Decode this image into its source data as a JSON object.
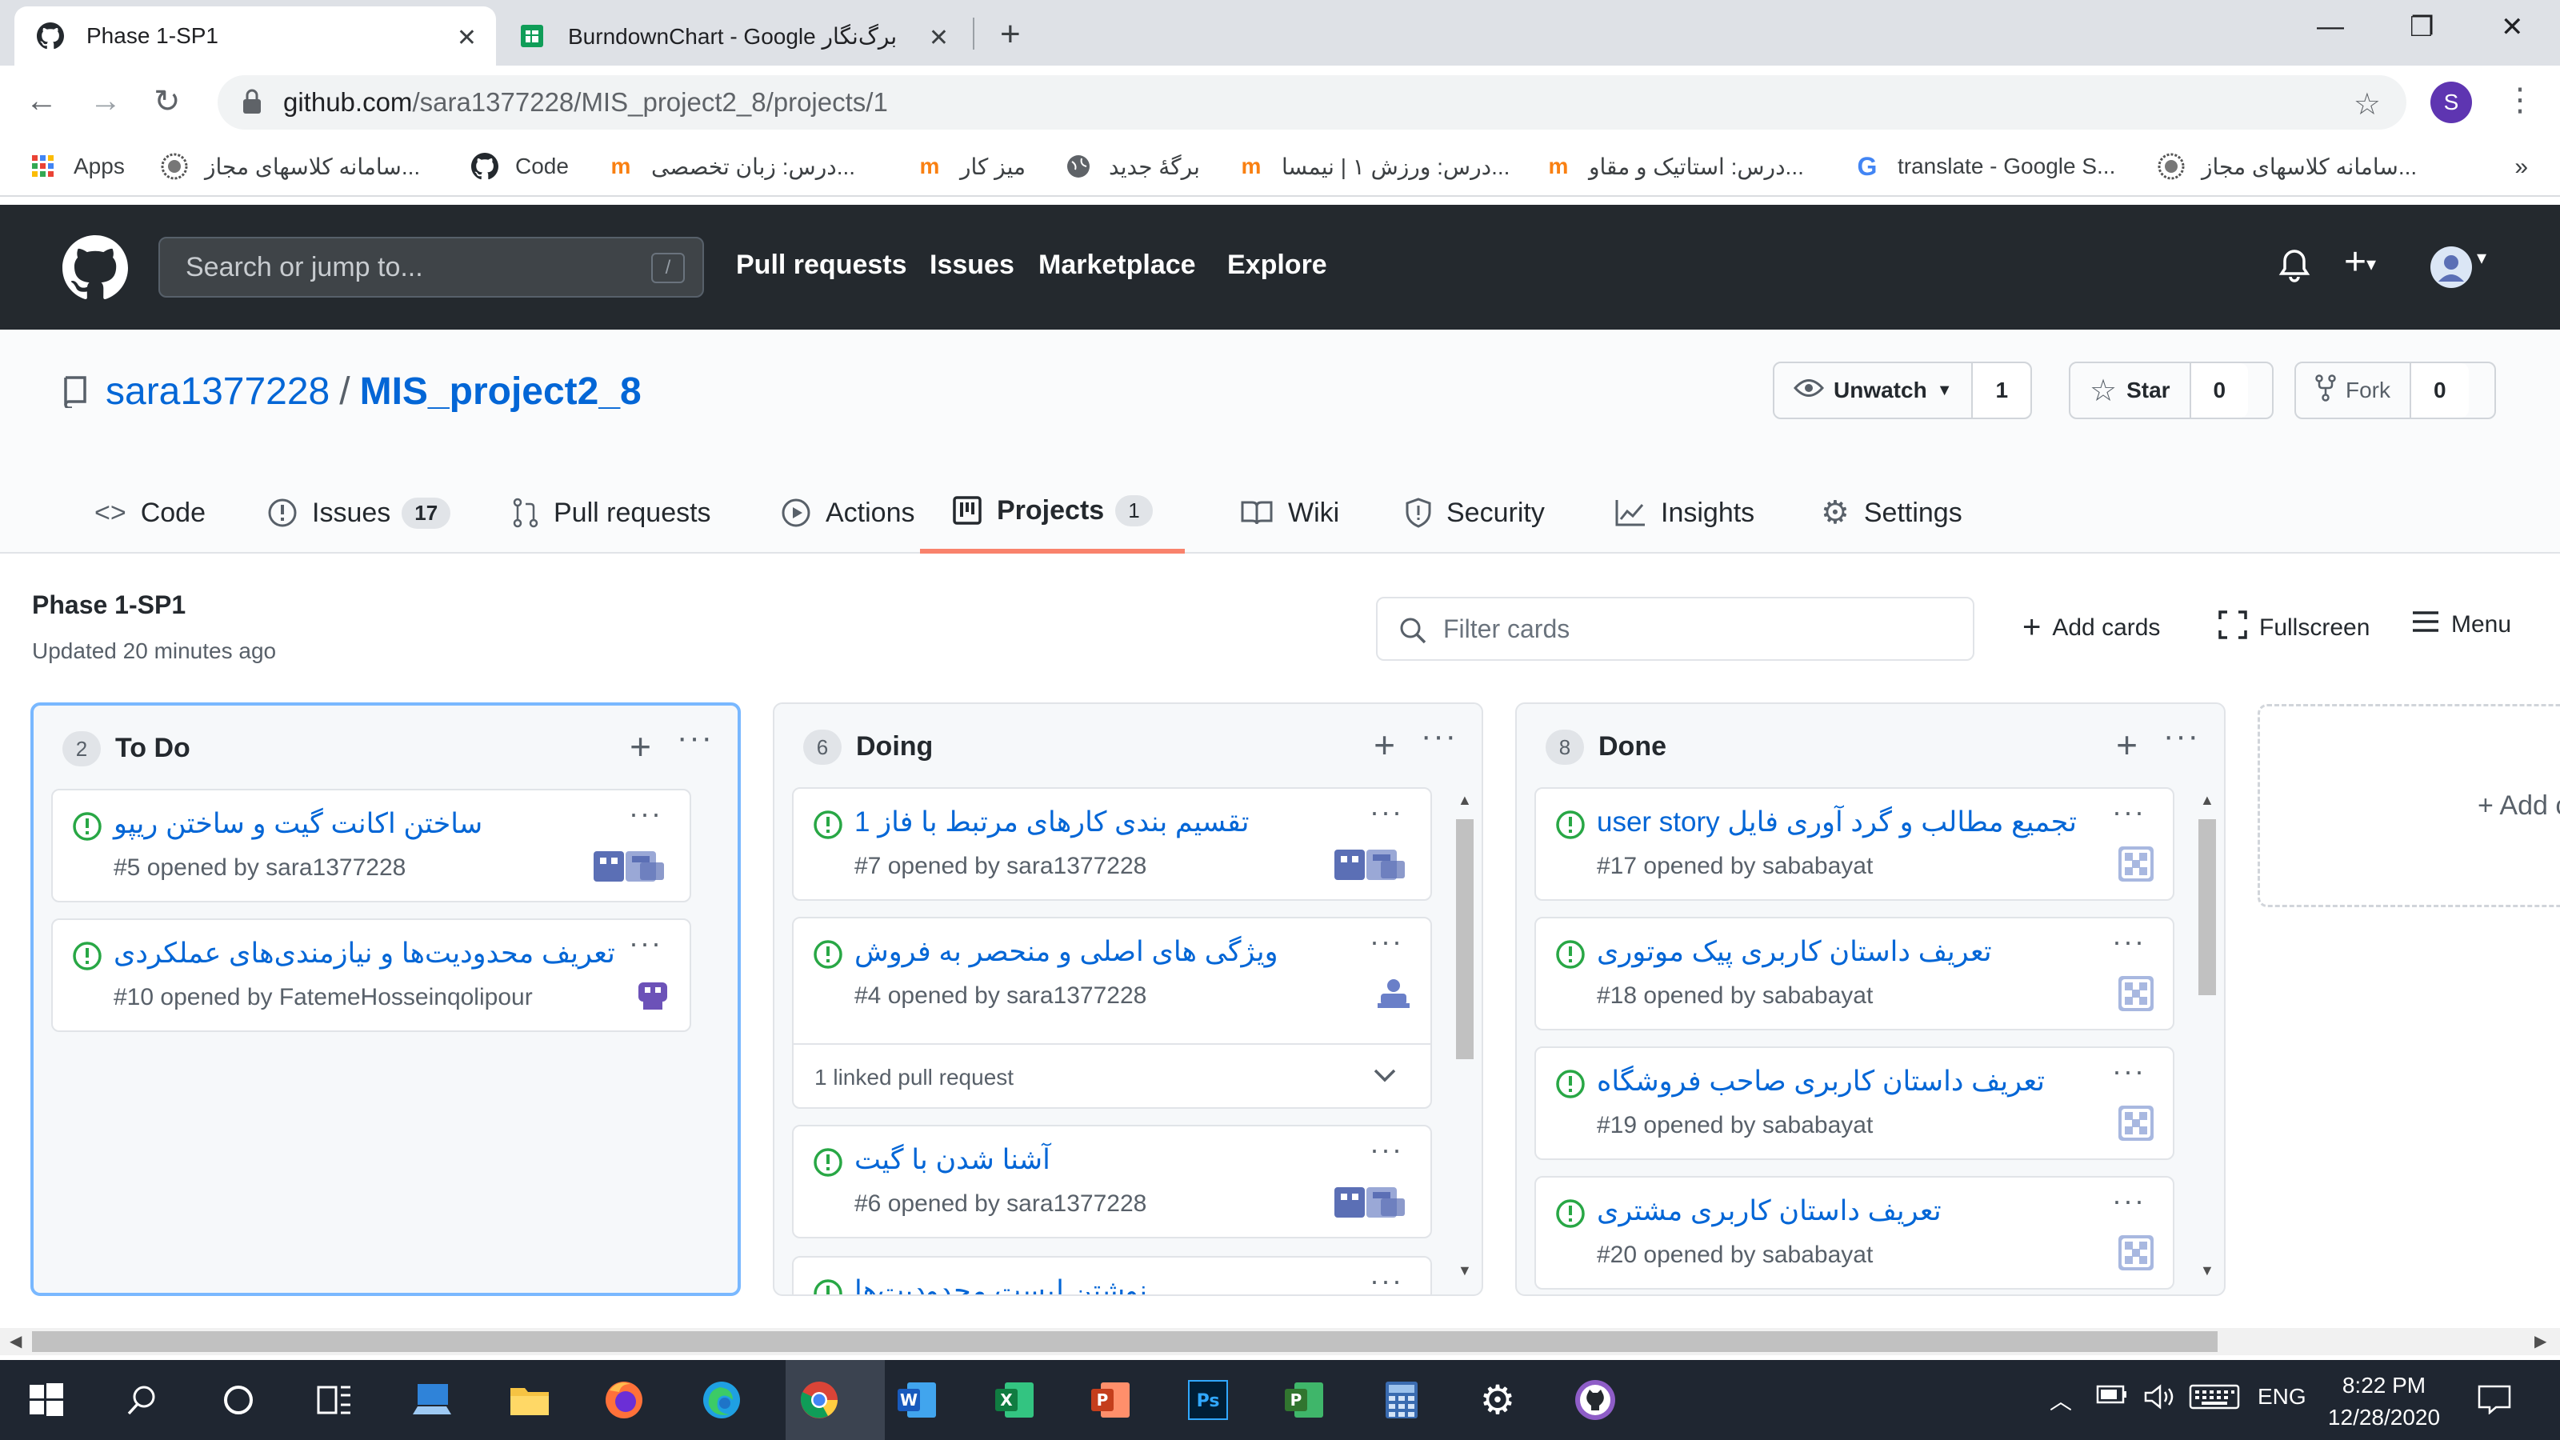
{
  "browser": {
    "tabs": [
      {
        "title": "Phase 1-SP1",
        "icon": "github-icon",
        "active": true
      },
      {
        "title": "BurndownChart - Google برگ‌نگار",
        "icon": "sheets-icon",
        "active": false
      }
    ],
    "close_glyph": "✕",
    "new_tab_glyph": "+",
    "url_host": "github.com",
    "url_path": "/sara1377228/MIS_project2_8/projects/1",
    "profile_initial": "S",
    "bookmarks": [
      {
        "label": "Apps",
        "icon": "apps-grid-icon"
      },
      {
        "label": "سامانه کلاسهای مجاز...",
        "icon": "seal-icon"
      },
      {
        "label": "Code",
        "icon": "github-icon"
      },
      {
        "label": "درس: زبان تخصصی...",
        "icon": "moodle-icon"
      },
      {
        "label": "میز کار",
        "icon": "moodle-icon"
      },
      {
        "label": "برگهٔ جدید",
        "icon": "globe-icon"
      },
      {
        "label": "درس: ورزش ۱ | نیمسا...",
        "icon": "moodle-icon"
      },
      {
        "label": "درس: استاتیک و مقاو...",
        "icon": "moodle-icon"
      },
      {
        "label": "translate - Google S...",
        "icon": "google-icon"
      },
      {
        "label": "سامانه کلاسهای مجاز...",
        "icon": "seal-icon"
      }
    ],
    "bookmarks_more": "»"
  },
  "github": {
    "search_placeholder": "Search or jump to...",
    "search_key": "/",
    "nav": [
      "Pull requests",
      "Issues",
      "Marketplace",
      "Explore"
    ]
  },
  "repo": {
    "owner": "sara1377228",
    "separator": "/",
    "name": "MIS_project2_8",
    "unwatch_label": "Unwatch",
    "watch_count": "1",
    "star_label": "Star",
    "star_count": "0",
    "fork_label": "Fork",
    "fork_count": "0",
    "tabs": [
      {
        "label": "Code",
        "icon": "code-icon",
        "counter": ""
      },
      {
        "label": "Issues",
        "icon": "issue-icon",
        "counter": "17"
      },
      {
        "label": "Pull requests",
        "icon": "pull-request-icon",
        "counter": ""
      },
      {
        "label": "Actions",
        "icon": "play-icon",
        "counter": ""
      },
      {
        "label": "Projects",
        "icon": "project-icon",
        "counter": "1",
        "selected": true
      },
      {
        "label": "Wiki",
        "icon": "book-icon",
        "counter": ""
      },
      {
        "label": "Security",
        "icon": "shield-icon",
        "counter": ""
      },
      {
        "label": "Insights",
        "icon": "graph-icon",
        "counter": ""
      },
      {
        "label": "Settings",
        "icon": "gear-icon",
        "counter": ""
      }
    ]
  },
  "project": {
    "title": "Phase 1-SP1",
    "updated": "Updated 20 minutes ago",
    "filter_placeholder": "Filter cards",
    "add_cards": "Add cards",
    "fullscreen": "Fullscreen",
    "menu": "Menu",
    "add_column": "+ Add column",
    "columns": [
      {
        "name": "To Do",
        "count": "2",
        "cards": [
          {
            "title": "ساختن اکانت گیت و ساختن ریپو",
            "meta": "#5 opened by sara1377228",
            "avatar": "multi"
          },
          {
            "title": "تعریف محدودیت‌ها و نیازمندی‌های عملکردی",
            "meta": "#10 opened by FatemeHosseinqolipour",
            "avatar": "purple"
          }
        ]
      },
      {
        "name": "Doing",
        "count": "6",
        "cards": [
          {
            "title": "تقسیم بندی کارهای مرتبط با فاز 1",
            "meta": "#7 opened by sara1377228",
            "avatar": "multi"
          },
          {
            "title": "ویژگی های اصلی و منحصر به فروش",
            "meta": "#4 opened by sara1377228",
            "avatar": "person",
            "linked": "1 linked pull request"
          },
          {
            "title": "آشنا شدن با گیت",
            "meta": "#6 opened by sara1377228",
            "avatar": "multi"
          },
          {
            "title": "نوشتن لیست محدودیت‌ها",
            "meta": "",
            "avatar": ""
          }
        ]
      },
      {
        "name": "Done",
        "count": "8",
        "cards": [
          {
            "title": "تجمیع مطالب و گرد آوری فایل user story",
            "meta": "#17 opened by sababayat",
            "avatar": "identicon"
          },
          {
            "title": "تعریف داستان کاربری پیک موتوری",
            "meta": "#18 opened by sababayat",
            "avatar": "identicon"
          },
          {
            "title": "تعریف داستان کاربری صاحب فروشگاه",
            "meta": "#19 opened by sababayat",
            "avatar": "identicon"
          },
          {
            "title": "تعریف داستان کاربری مشتری",
            "meta": "#20 opened by sababayat",
            "avatar": "identicon"
          }
        ]
      }
    ]
  },
  "taskbar": {
    "apps": [
      "windows-start-icon",
      "search-icon",
      "cortana-icon",
      "task-view-icon",
      "network-computer-icon",
      "file-explorer-icon",
      "firefox-icon",
      "edge-icon",
      "chrome-icon",
      "word-icon",
      "excel-icon",
      "powerpoint-icon",
      "photoshop-icon",
      "project-icon",
      "calculator-icon",
      "settings-icon",
      "github-desktop-icon"
    ],
    "lang": "ENG",
    "time": "8:22 PM",
    "date": "12/28/2020"
  },
  "colors": {
    "link": "#0366d6",
    "open_issue": "#28a745",
    "tab_underline": "#f9826c",
    "header": "#24292e"
  }
}
